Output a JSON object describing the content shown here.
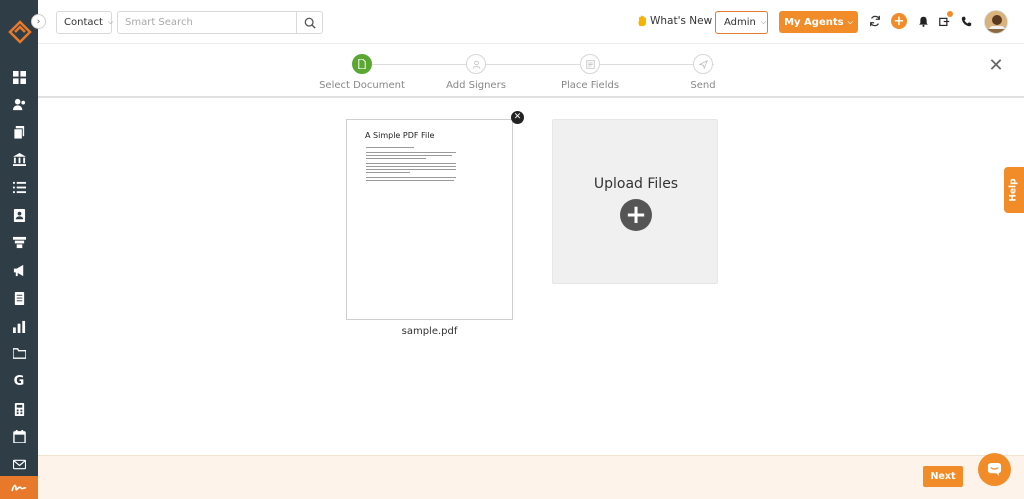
{
  "header": {
    "contact_label": "Contact",
    "search_placeholder": "Smart Search",
    "whats_new": "What's New",
    "admin_label": "Admin",
    "agents_label": "My Agents"
  },
  "sidebar": {
    "icons": [
      "logo-icon",
      "dashboard-icon",
      "contacts-icon",
      "documents-icon",
      "bank-icon",
      "list-icon",
      "profile-card-icon",
      "funnel-icon",
      "megaphone-icon",
      "notes-icon",
      "chart-icon",
      "folder-icon",
      "google-icon",
      "calculator-icon",
      "calendar-icon",
      "mail-icon",
      "signature-icon"
    ]
  },
  "stepper": {
    "steps": [
      {
        "label": "Select Document",
        "active": true
      },
      {
        "label": "Add Signers",
        "active": false
      },
      {
        "label": "Place Fields",
        "active": false
      },
      {
        "label": "Send",
        "active": false
      }
    ]
  },
  "document": {
    "preview_title": "A Simple PDF File",
    "file_name": "sample.pdf"
  },
  "upload": {
    "label": "Upload Files"
  },
  "help": {
    "label": "Help"
  },
  "footer": {
    "next_label": "Next"
  },
  "colors": {
    "accent": "#f28c28",
    "sidebar": "#2f3d47",
    "active_step": "#5aa832"
  }
}
